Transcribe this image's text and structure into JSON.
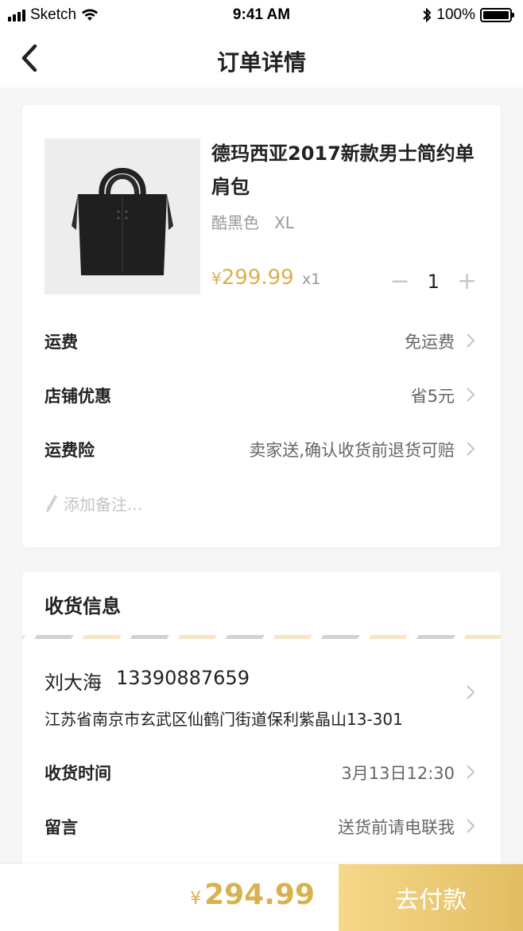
{
  "status_bar": {
    "carrier": "Sketch",
    "time": "9:41 AM",
    "battery": "100%"
  },
  "nav": {
    "title": "订单详情"
  },
  "product": {
    "name": "德玛西亚2017新款男士简约单肩包",
    "color": "酷黑色",
    "size": "XL",
    "currency": "¥",
    "price": "299.99",
    "qty_label": "x1",
    "quantity": "1"
  },
  "order_rows": [
    {
      "label": "运费",
      "value": "免运费"
    },
    {
      "label": "店铺优惠",
      "value": "省5元"
    },
    {
      "label": "运费险",
      "value": "卖家送,确认收货前退货可赔"
    }
  ],
  "note": {
    "placeholder": "添加备注..."
  },
  "shipping": {
    "title": "收货信息",
    "name": "刘大海",
    "phone": "13390887659",
    "address": "江苏省南京市玄武区仙鹤门街道保利紫晶山13-301",
    "rows": [
      {
        "label": "收货时间",
        "value": "3月13日12:30"
      },
      {
        "label": "留言",
        "value": "送货前请电联我"
      }
    ]
  },
  "footer": {
    "currency": "¥",
    "total": "294.99",
    "pay_label": "去付款"
  },
  "colors": {
    "accent": "#d8b24f",
    "button_start": "#f6d88a",
    "button_end": "#e2bd62"
  },
  "icons": [
    "back-arrow-icon",
    "chevron-right-icon",
    "pencil-icon",
    "wifi-icon",
    "bluetooth-icon",
    "battery-icon",
    "signal-icon"
  ]
}
